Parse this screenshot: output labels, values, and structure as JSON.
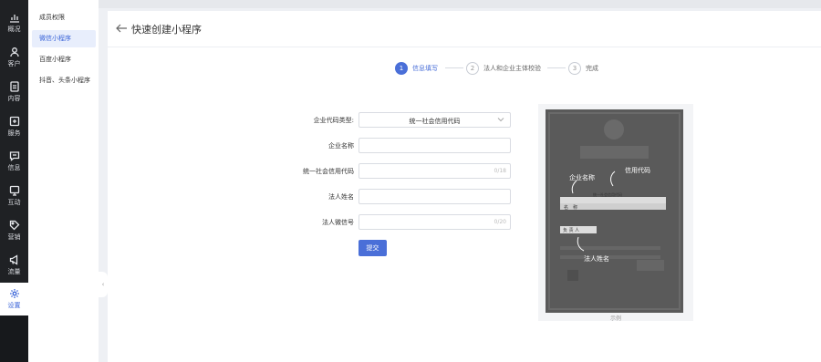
{
  "rail": {
    "items": [
      {
        "label": "概况",
        "icon": "chart-icon"
      },
      {
        "label": "客户",
        "icon": "user-icon"
      },
      {
        "label": "内容",
        "icon": "document-icon"
      },
      {
        "label": "服务",
        "icon": "service-icon"
      },
      {
        "label": "信息",
        "icon": "message-icon"
      },
      {
        "label": "互动",
        "icon": "interact-icon"
      },
      {
        "label": "营销",
        "icon": "tag-icon"
      },
      {
        "label": "流量",
        "icon": "megaphone-icon"
      },
      {
        "label": "设置",
        "icon": "gear-icon"
      }
    ],
    "active_color": "#3a64d8"
  },
  "submenu": {
    "items": [
      "成员权限",
      "微信小程序",
      "百度小程序",
      "抖音、头条小程序"
    ]
  },
  "page": {
    "title": "快速创建小程序"
  },
  "steps": [
    {
      "num": "1",
      "label": "信息填写"
    },
    {
      "num": "2",
      "label": "法人和企业主体校验"
    },
    {
      "num": "3",
      "label": "完成"
    }
  ],
  "form": {
    "code_type_label": "企业代码类型:",
    "code_type_value": "统一社会信用代码",
    "company_name_label": "企业名称",
    "credit_code_label": "统一社会信用代码",
    "credit_code_count": "0/18",
    "legal_name_label": "法人姓名",
    "legal_wechat_label": "法人微信号",
    "legal_wechat_count": "0/20",
    "submit_label": "提交"
  },
  "example": {
    "caption": "示例",
    "annotation_company": "企业名称",
    "annotation_code": "信用代码",
    "annotation_legal": "法人姓名",
    "field_name": "名　称",
    "field_legal": "负 责 人",
    "field_credit": "统一社会信用代码"
  },
  "colors": {
    "accent": "#4a6fd8"
  }
}
